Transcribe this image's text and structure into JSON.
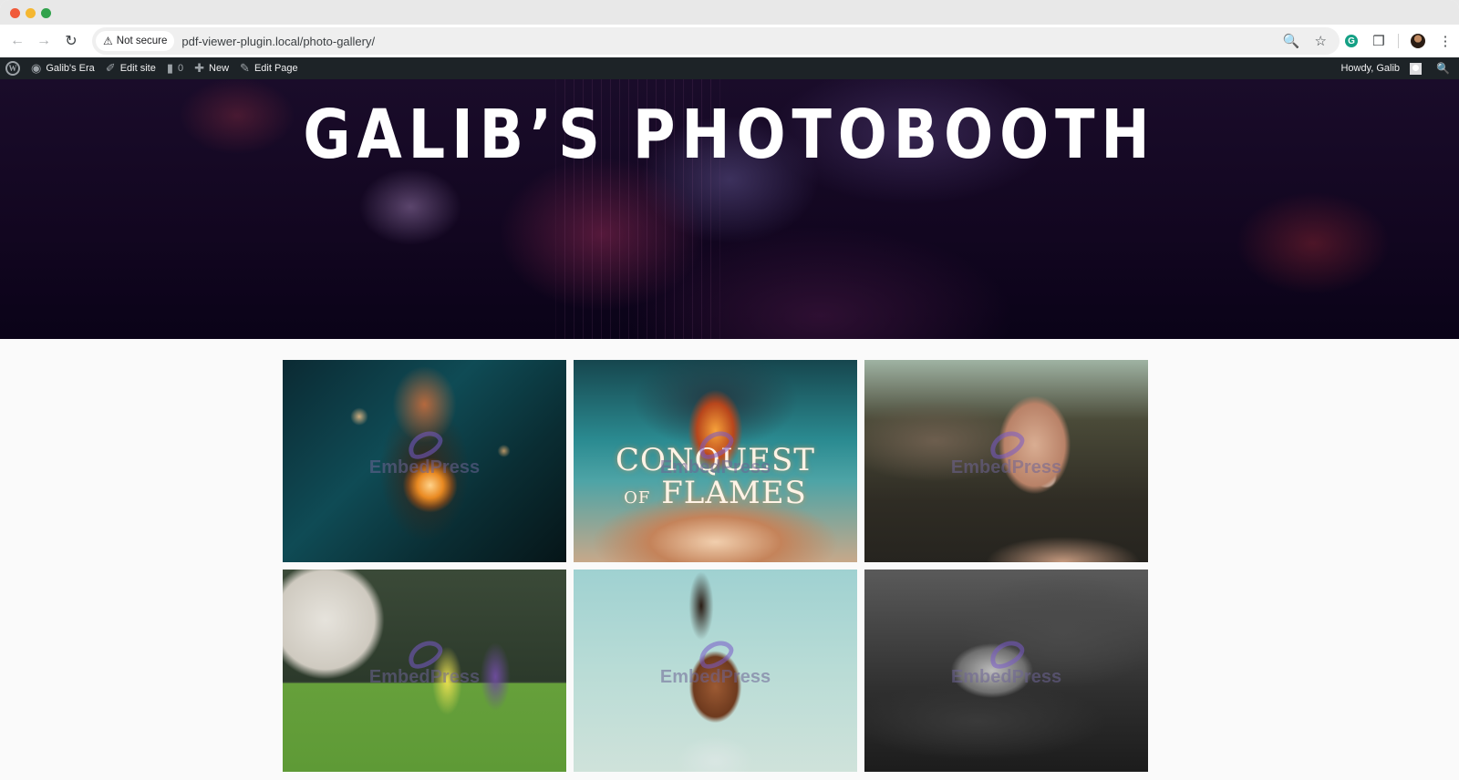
{
  "browser": {
    "security_label": "Not secure",
    "url": "pdf-viewer-plugin.local/photo-gallery/",
    "icons": {
      "back": "arrow-left-icon",
      "forward": "arrow-right-icon",
      "reload": "reload-icon",
      "zoom": "zoom-out-icon",
      "bookmark": "star-icon",
      "grammarly": "grammarly-icon",
      "extensions": "puzzle-icon",
      "menu": "kebab-menu-icon"
    },
    "grammarly_glyph": "G"
  },
  "admin_bar": {
    "wp_logo_glyph": "W",
    "site_name": "Galib's Era",
    "edit_site": "Edit site",
    "comments_count": "0",
    "new_label": "New",
    "edit_page": "Edit Page",
    "howdy": "Howdy, Galib"
  },
  "hero": {
    "title": "GALIB’S PHOTOBOOTH"
  },
  "gallery": {
    "watermark_text": "EmbedPress",
    "items": [
      {
        "alt": "Boy holding glowing orb"
      },
      {
        "alt": "Conquest of Flames poster",
        "overlay_line1": "CONQUEST",
        "overlay_small": "OF",
        "overlay_line2": "FLAMES"
      },
      {
        "alt": "Woman with flower in mouth"
      },
      {
        "alt": "Two cyclists with bikes in park"
      },
      {
        "alt": "Woman with braided bun and face art"
      },
      {
        "alt": "Black and white man hugging chicken"
      }
    ]
  }
}
